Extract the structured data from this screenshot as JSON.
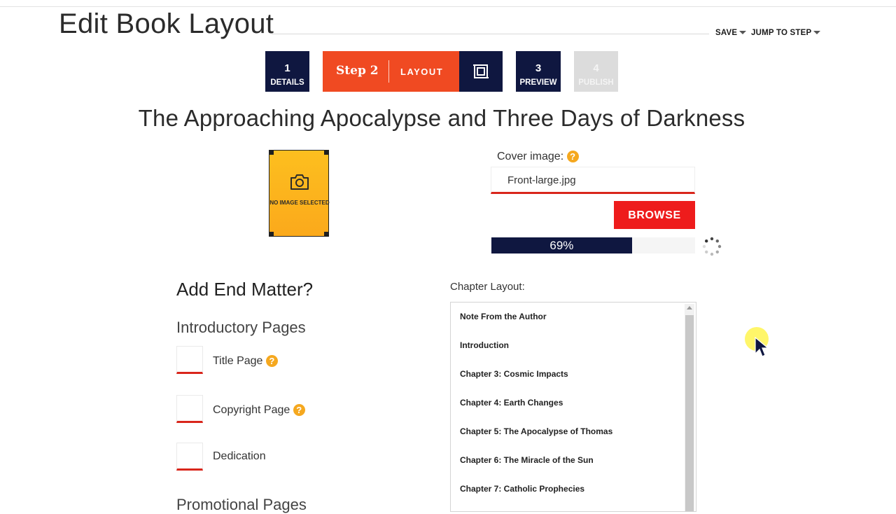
{
  "header": {
    "title": "Edit Book Layout",
    "save_label": "SAVE",
    "jump_label": "JUMP TO STEP"
  },
  "steps": [
    {
      "number": "1",
      "label": "DETAILS"
    },
    {
      "step_word": "Step 2",
      "label": "LAYOUT"
    },
    {
      "number": "3",
      "label": "PREVIEW"
    },
    {
      "number": "4",
      "label": "PUBLISH"
    }
  ],
  "book": {
    "title": "The Approaching Apocalypse and Three Days of Darkness"
  },
  "cover": {
    "placeholder_text": "NO IMAGE SELECTED",
    "label": "Cover image:",
    "file_value": "Front-large.jpg",
    "browse_label": "BROWSE",
    "progress_percent": 69,
    "progress_text": "69%"
  },
  "end_matter": {
    "title": "Add End Matter?",
    "intro_heading": "Introductory Pages",
    "options": [
      "Title Page",
      "Copyright Page",
      "Dedication"
    ],
    "promo_heading": "Promotional Pages"
  },
  "chapter_layout": {
    "label": "Chapter Layout:",
    "items": [
      "Note From the Author",
      "Introduction",
      "Chapter 3: Cosmic Impacts",
      "Chapter 4: Earth Changes",
      "Chapter 5: The Apocalypse of Thomas",
      "Chapter 6: The Miracle of the Sun",
      "Chapter 7: Catholic Prophecies"
    ]
  },
  "colors": {
    "navy": "#0f1740",
    "accent": "#f04a22",
    "browse_red": "#ee1c1c",
    "help_orange": "#f5a81f",
    "cover_yellow": "#fdbf1f"
  },
  "icons": {
    "camera": "camera-icon",
    "help": "help-icon",
    "layout_frame": "frame-icon",
    "spinner": "loading-spinner-icon",
    "caret": "caret-down-icon"
  }
}
